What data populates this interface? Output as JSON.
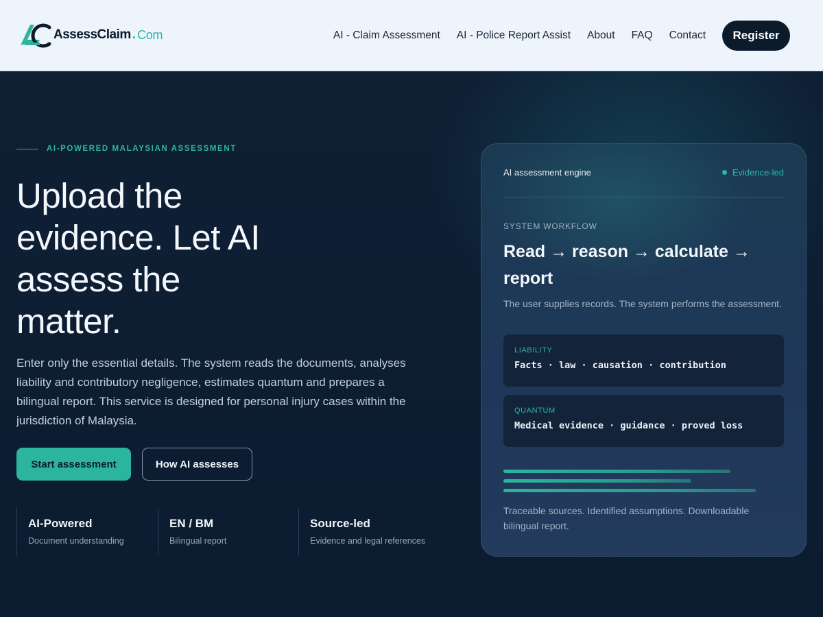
{
  "brand": {
    "name": "AssessClaim",
    "dot": ".",
    "tld": "Com",
    "accent_color": "#2bb5a0",
    "logo_icon": "ac-monogram-icon"
  },
  "nav": {
    "items": [
      {
        "label": "AI - Claim Assessment"
      },
      {
        "label": "AI - Police Report Assist"
      },
      {
        "label": "About"
      },
      {
        "label": "FAQ"
      },
      {
        "label": "Contact"
      }
    ],
    "register_label": "Register"
  },
  "hero": {
    "eyebrow": "AI-POWERED MALAYSIAN ASSESSMENT",
    "headline": "Upload the evidence. Let AI assess the matter.",
    "lede": "Enter only the essential details. The system reads the documents, analyses liability and contributory negligence, estimates quantum and prepares a bilingual report. This service is designed for personal injury cases within the jurisdiction of Malaysia.",
    "primary_button": "Start assessment",
    "secondary_button": "How AI assesses",
    "stats": [
      {
        "title": "AI-Powered",
        "subtitle": "Document understanding"
      },
      {
        "title": "EN / BM",
        "subtitle": "Bilingual report"
      },
      {
        "title": "Source-led",
        "subtitle": "Evidence and legal references"
      }
    ]
  },
  "card": {
    "header_left": "AI assessment engine",
    "header_right": "Evidence-led",
    "label": "SYSTEM WORKFLOW",
    "title": "Read → reason → calculate → report",
    "description": "The user supplies records. The system performs the assessment.",
    "boxes": [
      {
        "label": "LIABILITY",
        "text": "Facts · law · causation · contribution"
      },
      {
        "label": "QUANTUM",
        "text": "Medical evidence · guidance · proved loss"
      }
    ],
    "progress": [
      0.81,
      0.67,
      0.9
    ],
    "footer": "Traceable sources. Identified assumptions. Downloadable bilingual report."
  }
}
